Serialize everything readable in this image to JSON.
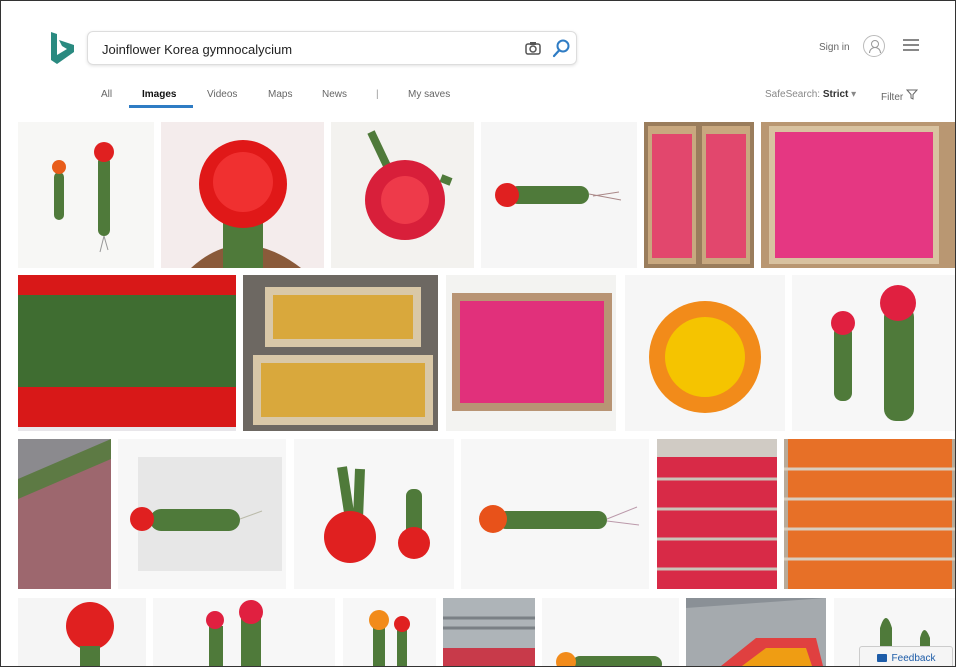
{
  "search": {
    "query": "Joinflower Korea gymnocalycium"
  },
  "header": {
    "sign_in": "Sign in"
  },
  "tabs": [
    "All",
    "Images",
    "Videos",
    "Maps",
    "News",
    "My saves"
  ],
  "divider": "|",
  "safesearch": {
    "label": "SafeSearch:",
    "value": "Strict"
  },
  "filter": {
    "label": "Filter"
  },
  "feedback": {
    "label": "Feedback"
  },
  "colors": {
    "accent": "#2f7cc4",
    "bing_logo": "#2a8a80",
    "flower_red": "#e02020",
    "flower_pink": "#e81e7c",
    "flower_yellow": "#f5c400",
    "stem_green": "#4f7a3a"
  }
}
